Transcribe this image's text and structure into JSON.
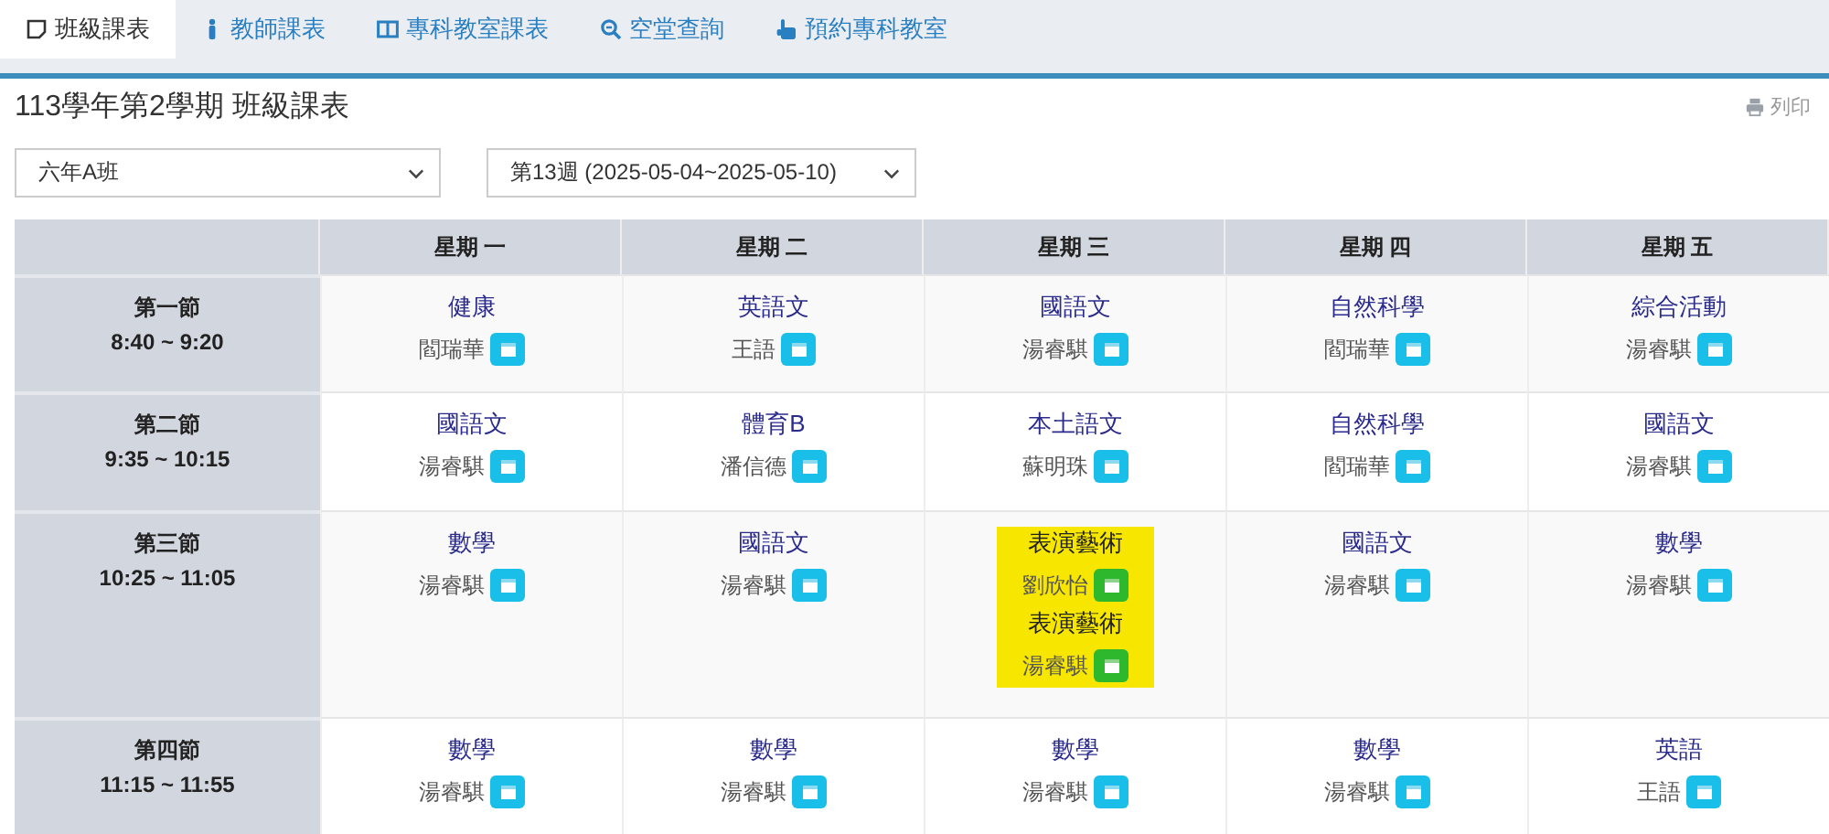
{
  "tabs": [
    {
      "label": "班級課表",
      "selected": true
    },
    {
      "label": "教師課表",
      "selected": false
    },
    {
      "label": "專科教室課表",
      "selected": false
    },
    {
      "label": "空堂查詢",
      "selected": false
    },
    {
      "label": "預約專科教室",
      "selected": false
    }
  ],
  "page_title": "113學年第2學期 班級課表",
  "print_button": "列印",
  "class_select": {
    "value": "六年A班"
  },
  "week_select": {
    "value": "第13週 (2025-05-04~2025-05-10)"
  },
  "table": {
    "columns": [
      "星期 一",
      "星期 二",
      "星期 三",
      "星期 四",
      "星期 五"
    ],
    "rows": [
      {
        "period": "第一節",
        "time": "8:40 ~ 9:20",
        "cells": [
          [
            {
              "subject": "健康",
              "teacher": "閻瑞華",
              "highlighted": false
            }
          ],
          [
            {
              "subject": "英語文",
              "teacher": "王語",
              "highlighted": false
            }
          ],
          [
            {
              "subject": "國語文",
              "teacher": "湯睿騏",
              "highlighted": false
            }
          ],
          [
            {
              "subject": "自然科學",
              "teacher": "閻瑞華",
              "highlighted": false
            }
          ],
          [
            {
              "subject": "綜合活動",
              "teacher": "湯睿騏",
              "highlighted": false
            }
          ]
        ]
      },
      {
        "period": "第二節",
        "time": "9:35 ~ 10:15",
        "cells": [
          [
            {
              "subject": "國語文",
              "teacher": "湯睿騏",
              "highlighted": false
            }
          ],
          [
            {
              "subject": "體育B",
              "teacher": "潘信德",
              "highlighted": false
            }
          ],
          [
            {
              "subject": "本土語文",
              "teacher": "蘇明珠",
              "highlighted": false
            }
          ],
          [
            {
              "subject": "自然科學",
              "teacher": "閻瑞華",
              "highlighted": false
            }
          ],
          [
            {
              "subject": "國語文",
              "teacher": "湯睿騏",
              "highlighted": false
            }
          ]
        ]
      },
      {
        "period": "第三節",
        "time": "10:25 ~ 11:05",
        "cells": [
          [
            {
              "subject": "數學",
              "teacher": "湯睿騏",
              "highlighted": false
            }
          ],
          [
            {
              "subject": "國語文",
              "teacher": "湯睿騏",
              "highlighted": false
            }
          ],
          [
            {
              "subject": "表演藝術",
              "teacher": "劉欣怡",
              "highlighted": true
            },
            {
              "subject": "表演藝術",
              "teacher": "湯睿騏",
              "highlighted": true
            }
          ],
          [
            {
              "subject": "國語文",
              "teacher": "湯睿騏",
              "highlighted": false
            }
          ],
          [
            {
              "subject": "數學",
              "teacher": "湯睿騏",
              "highlighted": false
            }
          ]
        ]
      },
      {
        "period": "第四節",
        "time": "11:15 ~ 11:55",
        "cells": [
          [
            {
              "subject": "數學",
              "teacher": "湯睿騏",
              "highlighted": false
            }
          ],
          [
            {
              "subject": "數學",
              "teacher": "湯睿騏",
              "highlighted": false
            }
          ],
          [
            {
              "subject": "數學",
              "teacher": "湯睿騏",
              "highlighted": false
            }
          ],
          [
            {
              "subject": "數學",
              "teacher": "湯睿騏",
              "highlighted": false
            }
          ],
          [
            {
              "subject": "英語",
              "teacher": "王語",
              "highlighted": false
            }
          ]
        ]
      }
    ]
  }
}
